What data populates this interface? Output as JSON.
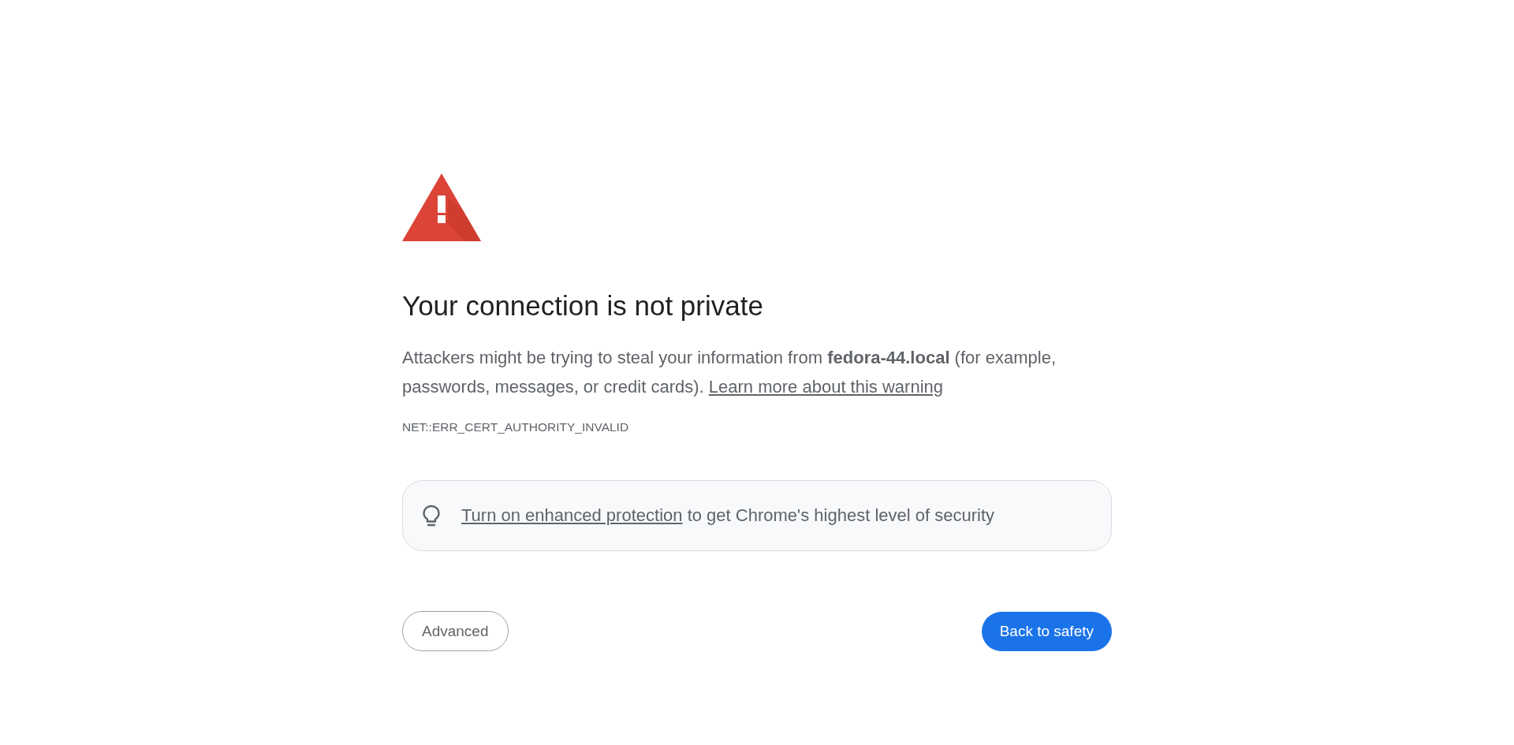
{
  "heading": "Your connection is not private",
  "message": {
    "text": "Attackers might be trying to steal your information from **fedora-44.local** (for example, passwords, messages, or credit cards).",
    "link": "Learn more about this warning"
  },
  "error_code": "NET::ERR_CERT_AUTHORITY_INVALID",
  "enhanced_protection": {
    "link": "Turn on enhanced protection",
    "text": "to get Chrome's highest level of security"
  },
  "buttons": [
    {
      "label": "Advanced",
      "kind": "secondary"
    },
    {
      "label": "Back to safety",
      "kind": "primary"
    }
  ]
}
